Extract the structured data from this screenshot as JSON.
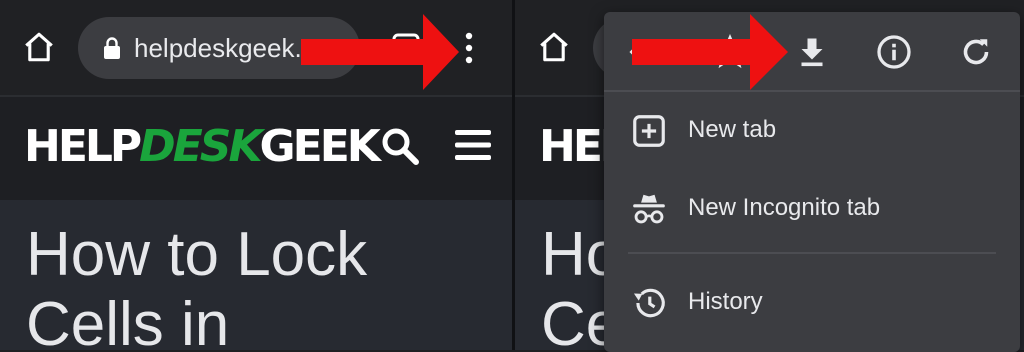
{
  "left_panel": {
    "toolbar": {
      "url": "helpdeskgeek.c",
      "home_icon": "home-icon",
      "lock_icon": "lock-icon",
      "tabs_icon": "tab-switcher-icon",
      "menu_icon": "more-vert-icon"
    },
    "site": {
      "logo_part1": "HELP",
      "logo_part2": "DESK",
      "logo_part3": "GEEK",
      "search_icon": "search-icon",
      "menu_icon": "hamburger-icon"
    },
    "article": {
      "title_line1": "How to Lock",
      "title_line2": "Cells in"
    }
  },
  "right_panel": {
    "logo_partial": "HELP",
    "article": {
      "title_line1": "Ho",
      "title_line2": "Ce"
    }
  },
  "menu": {
    "top_icons": [
      "back-icon",
      "bookmark-star-icon",
      "download-icon",
      "info-icon",
      "reload-icon"
    ],
    "items": [
      {
        "label": "New tab",
        "icon": "new-tab-plus-icon"
      },
      {
        "label": "New Incognito tab",
        "icon": "incognito-icon"
      },
      {
        "label": "History",
        "icon": "history-icon"
      }
    ]
  },
  "annotations": {
    "arrow_color": "#ee1111"
  },
  "colors": {
    "toolbar_bg": "#202124",
    "menu_bg": "#3c3d41",
    "logo_accent": "#1aa53c"
  }
}
